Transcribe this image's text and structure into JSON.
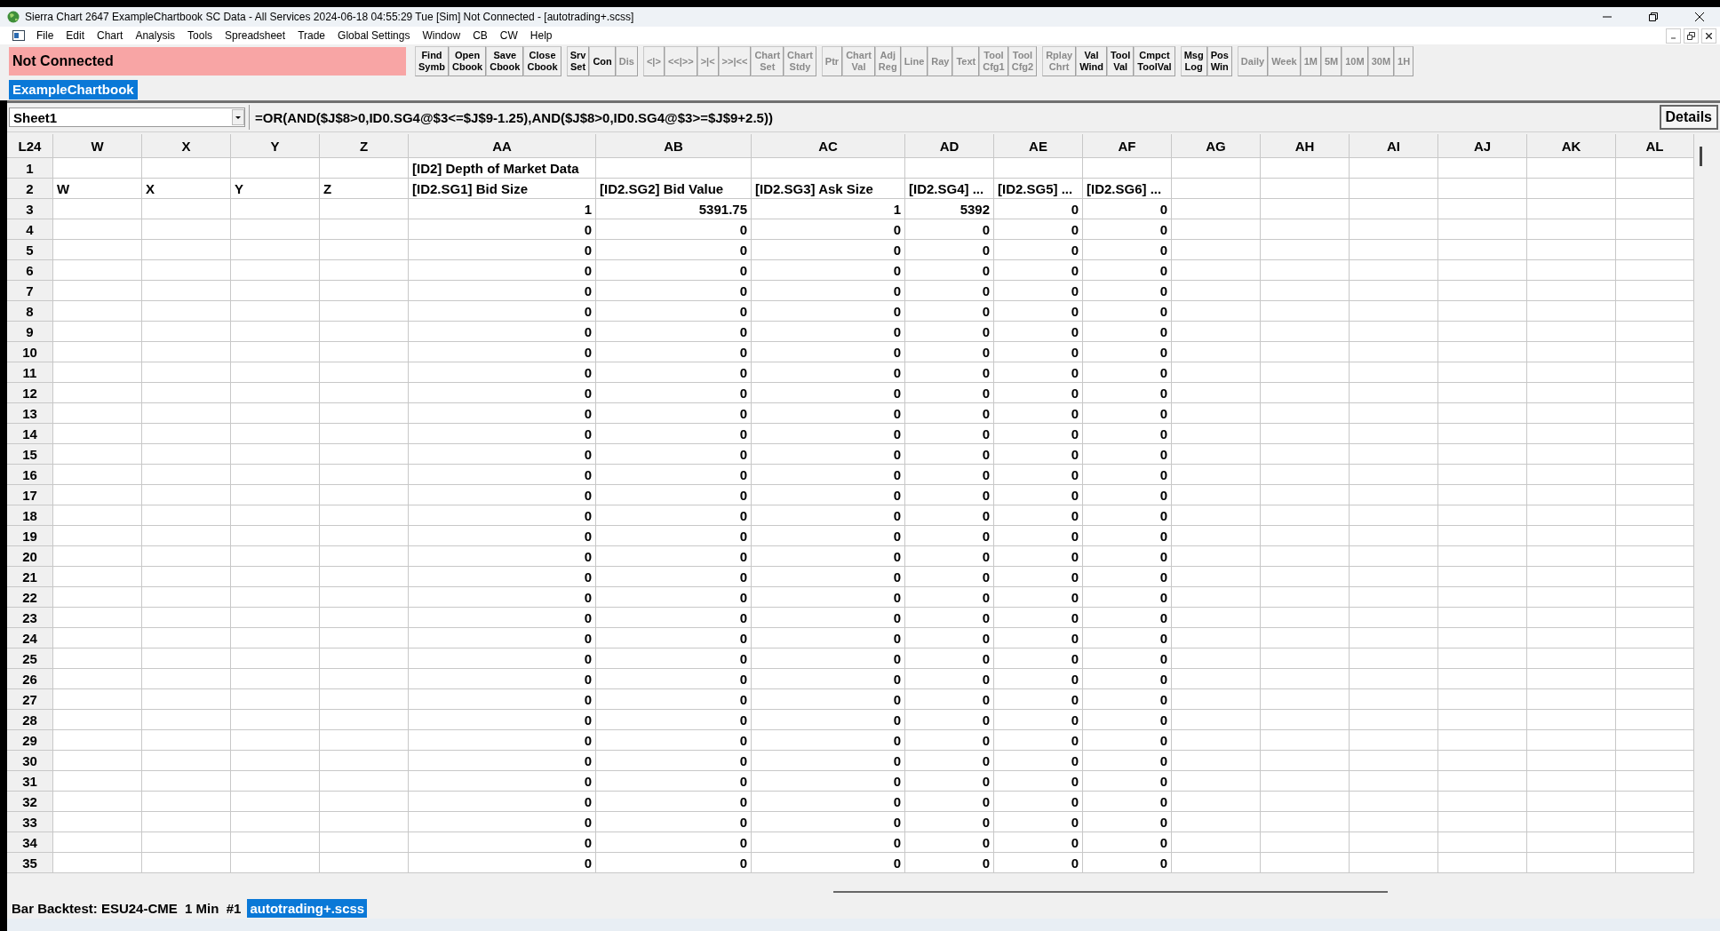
{
  "window": {
    "title": "Sierra Chart 2647 ExampleChartbook SC Data - All Services 2024-06-18  04:55:29 Tue [Sim] Not Connected - [autotrading+.scss]"
  },
  "menu": [
    "File",
    "Edit",
    "Chart",
    "Analysis",
    "Tools",
    "Spreadsheet",
    "Trade",
    "Global Settings",
    "Window",
    "CB",
    "CW",
    "Help"
  ],
  "status": {
    "text": "Not Connected"
  },
  "toolbar_groups": [
    [
      {
        "lines": [
          "Find",
          "Symb"
        ],
        "disabled": false
      },
      {
        "lines": [
          "Open",
          "Cbook"
        ],
        "disabled": false
      },
      {
        "lines": [
          "Save",
          "Cbook"
        ],
        "disabled": false
      },
      {
        "lines": [
          "Close",
          "Cbook"
        ],
        "disabled": false
      }
    ],
    [
      {
        "lines": [
          "Srv",
          "Set"
        ],
        "disabled": false
      },
      {
        "lines": [
          "Con"
        ],
        "disabled": false
      },
      {
        "lines": [
          "Dis"
        ],
        "disabled": true
      }
    ],
    [
      {
        "lines": [
          "<|>"
        ],
        "disabled": true
      },
      {
        "lines": [
          "<<|>>"
        ],
        "disabled": true
      },
      {
        "lines": [
          ">|<"
        ],
        "disabled": true
      },
      {
        "lines": [
          ">>|<<"
        ],
        "disabled": true
      },
      {
        "lines": [
          "Chart",
          "Set"
        ],
        "disabled": true
      },
      {
        "lines": [
          "Chart",
          "Stdy"
        ],
        "disabled": true
      }
    ],
    [
      {
        "lines": [
          "Ptr"
        ],
        "disabled": true
      },
      {
        "lines": [
          "Chart",
          "Val"
        ],
        "disabled": true
      },
      {
        "lines": [
          "Adj",
          "Reg"
        ],
        "disabled": true
      },
      {
        "lines": [
          "Line"
        ],
        "disabled": true
      },
      {
        "lines": [
          "Ray"
        ],
        "disabled": true
      },
      {
        "lines": [
          "Text"
        ],
        "disabled": true
      },
      {
        "lines": [
          "Tool",
          "Cfg1"
        ],
        "disabled": true
      },
      {
        "lines": [
          "Tool",
          "Cfg2"
        ],
        "disabled": true
      }
    ],
    [
      {
        "lines": [
          "Rplay",
          "Chrt"
        ],
        "disabled": true
      },
      {
        "lines": [
          "Val",
          "Wind"
        ],
        "disabled": false
      },
      {
        "lines": [
          "Tool",
          "Val"
        ],
        "disabled": false
      },
      {
        "lines": [
          "Cmpct",
          "ToolVal"
        ],
        "disabled": false
      }
    ],
    [
      {
        "lines": [
          "Msg",
          "Log"
        ],
        "disabled": false
      },
      {
        "lines": [
          "Pos",
          "Win"
        ],
        "disabled": false
      }
    ],
    [
      {
        "lines": [
          "Daily"
        ],
        "disabled": true
      },
      {
        "lines": [
          "Week"
        ],
        "disabled": true
      },
      {
        "lines": [
          "1M"
        ],
        "disabled": true
      },
      {
        "lines": [
          "5M"
        ],
        "disabled": true
      },
      {
        "lines": [
          "10M"
        ],
        "disabled": true
      },
      {
        "lines": [
          "30M"
        ],
        "disabled": true
      },
      {
        "lines": [
          "1H"
        ],
        "disabled": true
      }
    ]
  ],
  "chartbook_tab": {
    "label": "ExampleChartbook",
    "selected": true
  },
  "formula_bar": {
    "sheet": "Sheet1",
    "formula": "=OR(AND($J$8>0,ID0.SG4@$3<=$J$9-1.25),AND($J$8>0,ID0.SG4@$3>=$J$9+2.5))",
    "details_button": "Details"
  },
  "table": {
    "corner": "L24",
    "columns": [
      {
        "key": "W"
      },
      {
        "key": "X"
      },
      {
        "key": "Y"
      },
      {
        "key": "Z"
      },
      {
        "key": "AA"
      },
      {
        "key": "AB"
      },
      {
        "key": "AC"
      },
      {
        "key": "AD"
      },
      {
        "key": "AE"
      },
      {
        "key": "AF"
      },
      {
        "key": "AG"
      },
      {
        "key": "AH"
      },
      {
        "key": "AI"
      },
      {
        "key": "AJ"
      },
      {
        "key": "AK"
      },
      {
        "key": "AL"
      }
    ],
    "rows": [
      {
        "number": "1",
        "kind": "text",
        "cells": {
          "AA": "[ID2] Depth of Market Data"
        }
      },
      {
        "number": "2",
        "kind": "text",
        "cells": {
          "W": "W",
          "X": "X",
          "Y": "Y",
          "Z": "Z",
          "AA": "[ID2.SG1] Bid Size",
          "AB": "[ID2.SG2] Bid Value",
          "AC": "[ID2.SG3] Ask Size",
          "AD": "[ID2.SG4] ...",
          "AE": "[ID2.SG5] ...",
          "AF": "[ID2.SG6] ..."
        }
      },
      {
        "number": "3",
        "kind": "number",
        "cells": {
          "AA": "1",
          "AB": "5391.75",
          "AC": "1",
          "AD": "5392",
          "AE": "0",
          "AF": "0"
        }
      },
      {
        "number": "4",
        "kind": "number",
        "cells": {
          "AA": "0",
          "AB": "0",
          "AC": "0",
          "AD": "0",
          "AE": "0",
          "AF": "0"
        }
      },
      {
        "number": "5",
        "kind": "number",
        "cells": {
          "AA": "0",
          "AB": "0",
          "AC": "0",
          "AD": "0",
          "AE": "0",
          "AF": "0"
        }
      },
      {
        "number": "6",
        "kind": "number",
        "cells": {
          "AA": "0",
          "AB": "0",
          "AC": "0",
          "AD": "0",
          "AE": "0",
          "AF": "0"
        }
      },
      {
        "number": "7",
        "kind": "number",
        "cells": {
          "AA": "0",
          "AB": "0",
          "AC": "0",
          "AD": "0",
          "AE": "0",
          "AF": "0"
        }
      },
      {
        "number": "8",
        "kind": "number",
        "cells": {
          "AA": "0",
          "AB": "0",
          "AC": "0",
          "AD": "0",
          "AE": "0",
          "AF": "0"
        }
      },
      {
        "number": "9",
        "kind": "number",
        "cells": {
          "AA": "0",
          "AB": "0",
          "AC": "0",
          "AD": "0",
          "AE": "0",
          "AF": "0"
        }
      },
      {
        "number": "10",
        "kind": "number",
        "cells": {
          "AA": "0",
          "AB": "0",
          "AC": "0",
          "AD": "0",
          "AE": "0",
          "AF": "0"
        }
      },
      {
        "number": "11",
        "kind": "number",
        "cells": {
          "AA": "0",
          "AB": "0",
          "AC": "0",
          "AD": "0",
          "AE": "0",
          "AF": "0"
        }
      },
      {
        "number": "12",
        "kind": "number",
        "cells": {
          "AA": "0",
          "AB": "0",
          "AC": "0",
          "AD": "0",
          "AE": "0",
          "AF": "0"
        }
      },
      {
        "number": "13",
        "kind": "number",
        "cells": {
          "AA": "0",
          "AB": "0",
          "AC": "0",
          "AD": "0",
          "AE": "0",
          "AF": "0"
        }
      },
      {
        "number": "14",
        "kind": "number",
        "cells": {
          "AA": "0",
          "AB": "0",
          "AC": "0",
          "AD": "0",
          "AE": "0",
          "AF": "0"
        }
      },
      {
        "number": "15",
        "kind": "number",
        "cells": {
          "AA": "0",
          "AB": "0",
          "AC": "0",
          "AD": "0",
          "AE": "0",
          "AF": "0"
        }
      },
      {
        "number": "16",
        "kind": "number",
        "cells": {
          "AA": "0",
          "AB": "0",
          "AC": "0",
          "AD": "0",
          "AE": "0",
          "AF": "0"
        }
      },
      {
        "number": "17",
        "kind": "number",
        "cells": {
          "AA": "0",
          "AB": "0",
          "AC": "0",
          "AD": "0",
          "AE": "0",
          "AF": "0"
        }
      },
      {
        "number": "18",
        "kind": "number",
        "cells": {
          "AA": "0",
          "AB": "0",
          "AC": "0",
          "AD": "0",
          "AE": "0",
          "AF": "0"
        }
      },
      {
        "number": "19",
        "kind": "number",
        "cells": {
          "AA": "0",
          "AB": "0",
          "AC": "0",
          "AD": "0",
          "AE": "0",
          "AF": "0"
        }
      },
      {
        "number": "20",
        "kind": "number",
        "cells": {
          "AA": "0",
          "AB": "0",
          "AC": "0",
          "AD": "0",
          "AE": "0",
          "AF": "0"
        }
      },
      {
        "number": "21",
        "kind": "number",
        "cells": {
          "AA": "0",
          "AB": "0",
          "AC": "0",
          "AD": "0",
          "AE": "0",
          "AF": "0"
        }
      },
      {
        "number": "22",
        "kind": "number",
        "cells": {
          "AA": "0",
          "AB": "0",
          "AC": "0",
          "AD": "0",
          "AE": "0",
          "AF": "0"
        }
      },
      {
        "number": "23",
        "kind": "number",
        "cells": {
          "AA": "0",
          "AB": "0",
          "AC": "0",
          "AD": "0",
          "AE": "0",
          "AF": "0"
        }
      },
      {
        "number": "24",
        "kind": "number",
        "cells": {
          "AA": "0",
          "AB": "0",
          "AC": "0",
          "AD": "0",
          "AE": "0",
          "AF": "0"
        }
      },
      {
        "number": "25",
        "kind": "number",
        "cells": {
          "AA": "0",
          "AB": "0",
          "AC": "0",
          "AD": "0",
          "AE": "0",
          "AF": "0"
        }
      },
      {
        "number": "26",
        "kind": "number",
        "cells": {
          "AA": "0",
          "AB": "0",
          "AC": "0",
          "AD": "0",
          "AE": "0",
          "AF": "0"
        }
      },
      {
        "number": "27",
        "kind": "number",
        "cells": {
          "AA": "0",
          "AB": "0",
          "AC": "0",
          "AD": "0",
          "AE": "0",
          "AF": "0"
        }
      },
      {
        "number": "28",
        "kind": "number",
        "cells": {
          "AA": "0",
          "AB": "0",
          "AC": "0",
          "AD": "0",
          "AE": "0",
          "AF": "0"
        }
      },
      {
        "number": "29",
        "kind": "number",
        "cells": {
          "AA": "0",
          "AB": "0",
          "AC": "0",
          "AD": "0",
          "AE": "0",
          "AF": "0"
        }
      },
      {
        "number": "30",
        "kind": "number",
        "cells": {
          "AA": "0",
          "AB": "0",
          "AC": "0",
          "AD": "0",
          "AE": "0",
          "AF": "0"
        }
      },
      {
        "number": "31",
        "kind": "number",
        "cells": {
          "AA": "0",
          "AB": "0",
          "AC": "0",
          "AD": "0",
          "AE": "0",
          "AF": "0"
        }
      },
      {
        "number": "32",
        "kind": "number",
        "cells": {
          "AA": "0",
          "AB": "0",
          "AC": "0",
          "AD": "0",
          "AE": "0",
          "AF": "0"
        }
      },
      {
        "number": "33",
        "kind": "number",
        "cells": {
          "AA": "0",
          "AB": "0",
          "AC": "0",
          "AD": "0",
          "AE": "0",
          "AF": "0"
        }
      },
      {
        "number": "34",
        "kind": "number",
        "cells": {
          "AA": "0",
          "AB": "0",
          "AC": "0",
          "AD": "0",
          "AE": "0",
          "AF": "0"
        }
      },
      {
        "number": "35",
        "kind": "number",
        "cells": {
          "AA": "0",
          "AB": "0",
          "AC": "0",
          "AD": "0",
          "AE": "0",
          "AF": "0"
        }
      }
    ]
  },
  "bottom_tabs": [
    {
      "label": "Bar Backtest: ESU24-CME  1 Min  #1",
      "selected": false
    },
    {
      "label": "autotrading+.scss",
      "selected": true
    }
  ]
}
